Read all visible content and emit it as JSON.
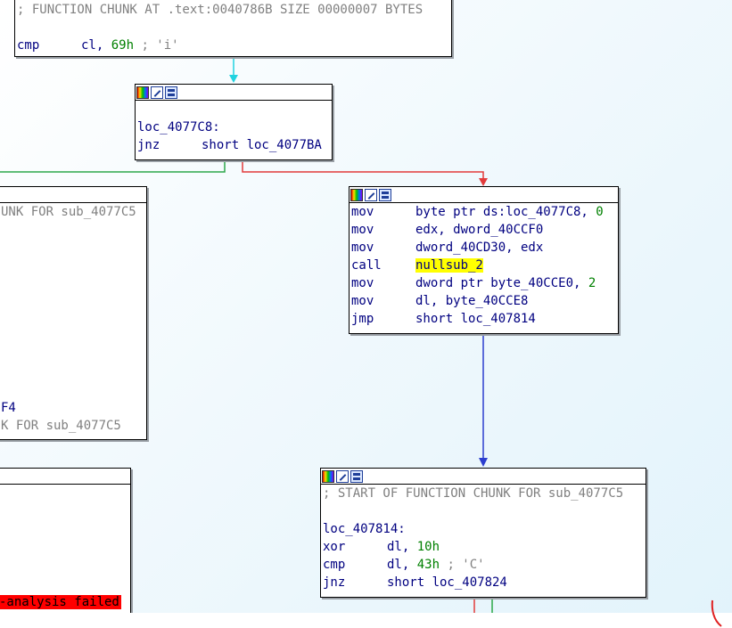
{
  "top_block": {
    "comment": "; FUNCTION CHUNK AT .text:0040786B SIZE 00000007 BYTES",
    "mnemonic": "cmp",
    "op1": "cl, ",
    "imm": "69h",
    "trailing_comment": " ; 'i'"
  },
  "block_4077c8": {
    "label": "loc_4077C8:",
    "mnemonic": "jnz",
    "operand": "short loc_4077BA"
  },
  "left_block": {
    "line1": "UNK FOR sub_4077C5",
    "line2": "F4",
    "line3": "K FOR sub_4077C5"
  },
  "mid_block": {
    "lines": [
      {
        "mn": "mov",
        "op": "byte ptr ds:loc_4077C8, ",
        "num": "0"
      },
      {
        "mn": "mov",
        "op": "edx, dword_40CCF0"
      },
      {
        "mn": "mov",
        "op": "dword_40CD30, edx"
      },
      {
        "mn": "call",
        "op": "nullsub_2"
      },
      {
        "mn": "mov",
        "op": "dword ptr byte_40CCE0, ",
        "num": "2"
      },
      {
        "mn": "mov",
        "op": "dl, byte_40CCE8"
      },
      {
        "mn": "jmp",
        "op": "short loc_407814"
      }
    ]
  },
  "bottom_left_block": {
    "error": "-analysis failed"
  },
  "block_407814": {
    "comment": "; START OF FUNCTION CHUNK FOR sub_4077C5",
    "label": "loc_407814:",
    "lines": [
      {
        "mn": "xor",
        "op": "dl, ",
        "num": "10h",
        "cmt": ""
      },
      {
        "mn": "cmp",
        "op": "dl, ",
        "num": "43h",
        "cmt": " ; 'C'"
      },
      {
        "mn": "jnz",
        "op": "short loc_407824",
        "num": "",
        "cmt": ""
      }
    ]
  },
  "colors": {
    "edge_unconditional": "#22d3e0",
    "edge_true": "#2da84a",
    "edge_false": "#e23b3b",
    "edge_jump": "#2c3ecf",
    "highlight": "#ffff00",
    "error_bg": "#ff0000"
  }
}
